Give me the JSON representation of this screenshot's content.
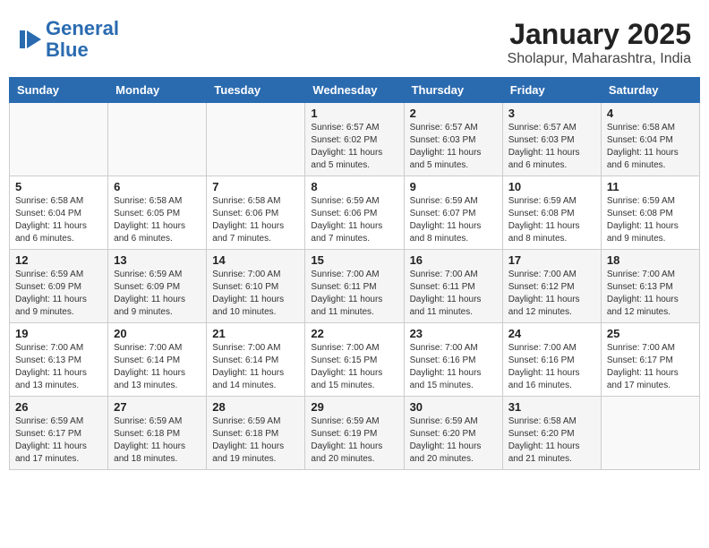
{
  "header": {
    "logo_line1": "General",
    "logo_line2": "Blue",
    "title": "January 2025",
    "subtitle": "Sholapur, Maharashtra, India"
  },
  "days_of_week": [
    "Sunday",
    "Monday",
    "Tuesday",
    "Wednesday",
    "Thursday",
    "Friday",
    "Saturday"
  ],
  "weeks": [
    [
      {
        "day": "",
        "info": ""
      },
      {
        "day": "",
        "info": ""
      },
      {
        "day": "",
        "info": ""
      },
      {
        "day": "1",
        "info": "Sunrise: 6:57 AM\nSunset: 6:02 PM\nDaylight: 11 hours\nand 5 minutes."
      },
      {
        "day": "2",
        "info": "Sunrise: 6:57 AM\nSunset: 6:03 PM\nDaylight: 11 hours\nand 5 minutes."
      },
      {
        "day": "3",
        "info": "Sunrise: 6:57 AM\nSunset: 6:03 PM\nDaylight: 11 hours\nand 6 minutes."
      },
      {
        "day": "4",
        "info": "Sunrise: 6:58 AM\nSunset: 6:04 PM\nDaylight: 11 hours\nand 6 minutes."
      }
    ],
    [
      {
        "day": "5",
        "info": "Sunrise: 6:58 AM\nSunset: 6:04 PM\nDaylight: 11 hours\nand 6 minutes."
      },
      {
        "day": "6",
        "info": "Sunrise: 6:58 AM\nSunset: 6:05 PM\nDaylight: 11 hours\nand 6 minutes."
      },
      {
        "day": "7",
        "info": "Sunrise: 6:58 AM\nSunset: 6:06 PM\nDaylight: 11 hours\nand 7 minutes."
      },
      {
        "day": "8",
        "info": "Sunrise: 6:59 AM\nSunset: 6:06 PM\nDaylight: 11 hours\nand 7 minutes."
      },
      {
        "day": "9",
        "info": "Sunrise: 6:59 AM\nSunset: 6:07 PM\nDaylight: 11 hours\nand 8 minutes."
      },
      {
        "day": "10",
        "info": "Sunrise: 6:59 AM\nSunset: 6:08 PM\nDaylight: 11 hours\nand 8 minutes."
      },
      {
        "day": "11",
        "info": "Sunrise: 6:59 AM\nSunset: 6:08 PM\nDaylight: 11 hours\nand 9 minutes."
      }
    ],
    [
      {
        "day": "12",
        "info": "Sunrise: 6:59 AM\nSunset: 6:09 PM\nDaylight: 11 hours\nand 9 minutes."
      },
      {
        "day": "13",
        "info": "Sunrise: 6:59 AM\nSunset: 6:09 PM\nDaylight: 11 hours\nand 9 minutes."
      },
      {
        "day": "14",
        "info": "Sunrise: 7:00 AM\nSunset: 6:10 PM\nDaylight: 11 hours\nand 10 minutes."
      },
      {
        "day": "15",
        "info": "Sunrise: 7:00 AM\nSunset: 6:11 PM\nDaylight: 11 hours\nand 11 minutes."
      },
      {
        "day": "16",
        "info": "Sunrise: 7:00 AM\nSunset: 6:11 PM\nDaylight: 11 hours\nand 11 minutes."
      },
      {
        "day": "17",
        "info": "Sunrise: 7:00 AM\nSunset: 6:12 PM\nDaylight: 11 hours\nand 12 minutes."
      },
      {
        "day": "18",
        "info": "Sunrise: 7:00 AM\nSunset: 6:13 PM\nDaylight: 11 hours\nand 12 minutes."
      }
    ],
    [
      {
        "day": "19",
        "info": "Sunrise: 7:00 AM\nSunset: 6:13 PM\nDaylight: 11 hours\nand 13 minutes."
      },
      {
        "day": "20",
        "info": "Sunrise: 7:00 AM\nSunset: 6:14 PM\nDaylight: 11 hours\nand 13 minutes."
      },
      {
        "day": "21",
        "info": "Sunrise: 7:00 AM\nSunset: 6:14 PM\nDaylight: 11 hours\nand 14 minutes."
      },
      {
        "day": "22",
        "info": "Sunrise: 7:00 AM\nSunset: 6:15 PM\nDaylight: 11 hours\nand 15 minutes."
      },
      {
        "day": "23",
        "info": "Sunrise: 7:00 AM\nSunset: 6:16 PM\nDaylight: 11 hours\nand 15 minutes."
      },
      {
        "day": "24",
        "info": "Sunrise: 7:00 AM\nSunset: 6:16 PM\nDaylight: 11 hours\nand 16 minutes."
      },
      {
        "day": "25",
        "info": "Sunrise: 7:00 AM\nSunset: 6:17 PM\nDaylight: 11 hours\nand 17 minutes."
      }
    ],
    [
      {
        "day": "26",
        "info": "Sunrise: 6:59 AM\nSunset: 6:17 PM\nDaylight: 11 hours\nand 17 minutes."
      },
      {
        "day": "27",
        "info": "Sunrise: 6:59 AM\nSunset: 6:18 PM\nDaylight: 11 hours\nand 18 minutes."
      },
      {
        "day": "28",
        "info": "Sunrise: 6:59 AM\nSunset: 6:18 PM\nDaylight: 11 hours\nand 19 minutes."
      },
      {
        "day": "29",
        "info": "Sunrise: 6:59 AM\nSunset: 6:19 PM\nDaylight: 11 hours\nand 20 minutes."
      },
      {
        "day": "30",
        "info": "Sunrise: 6:59 AM\nSunset: 6:20 PM\nDaylight: 11 hours\nand 20 minutes."
      },
      {
        "day": "31",
        "info": "Sunrise: 6:58 AM\nSunset: 6:20 PM\nDaylight: 11 hours\nand 21 minutes."
      },
      {
        "day": "",
        "info": ""
      }
    ]
  ]
}
